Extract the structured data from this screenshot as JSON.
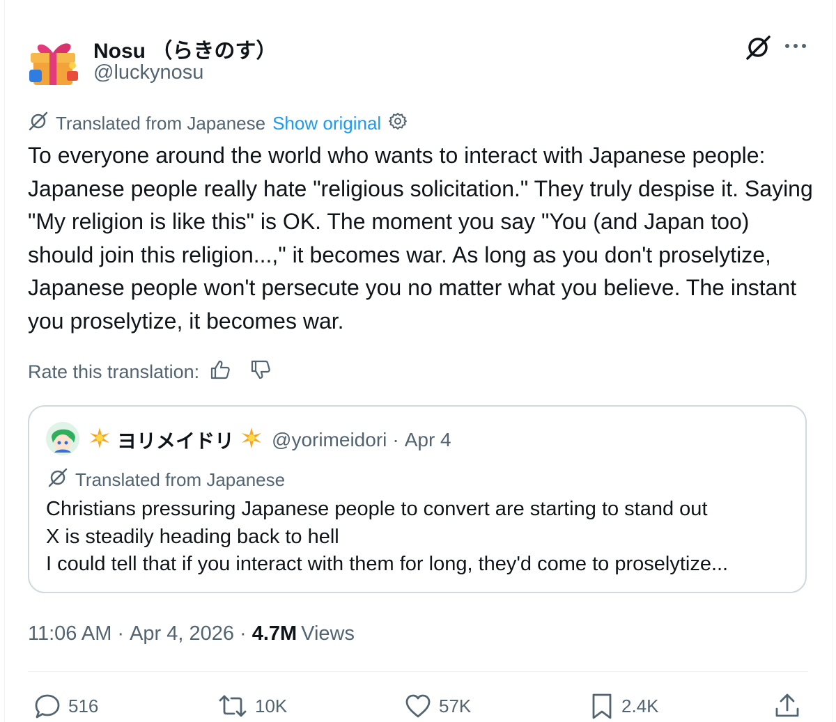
{
  "author": {
    "display_name": "Nosu （らきのす）",
    "handle": "@luckynosu"
  },
  "translation": {
    "label": "Translated from Japanese",
    "show_original": "Show original"
  },
  "post_text": "To everyone around the world who wants to interact with Japanese people: Japanese people really hate \"religious solicitation.\" They truly despise it. Saying \"My religion is like this\" is OK. The moment you say \"You (and Japan too) should join this religion...,\" it becomes war. As long as you don't proselytize, Japanese people won't persecute you no matter what you believe. The instant you proselytize, it becomes war.",
  "rate": {
    "label": "Rate this translation:"
  },
  "quote": {
    "display_name": "ヨリメイドリ",
    "handle": "@yorimeidori",
    "dot": "·",
    "date": "Apr 4",
    "translation_label": "Translated from Japanese",
    "lines": [
      "Christians pressuring Japanese people to convert are starting to stand out",
      "X is steadily heading back to hell",
      "I could tell that if you interact with them for long, they'd come to proselytize..."
    ]
  },
  "meta": {
    "time": "11:06 AM",
    "sep1": "·",
    "date": "Apr 4, 2026",
    "sep2": "·",
    "views_count": "4.7M",
    "views_label": "Views"
  },
  "actions": {
    "replies": "516",
    "reposts": "10K",
    "likes": "57K",
    "bookmarks": "2.4K"
  },
  "colors": {
    "link": "#1d9bf0",
    "secondary_text": "#536471",
    "primary_text": "#0f1419",
    "border": "#cfd9de"
  },
  "icons": [
    "grok-icon",
    "more-icon",
    "translate-icon",
    "settings-gear-icon",
    "thumbs-up-icon",
    "thumbs-down-icon",
    "reply-icon",
    "repost-icon",
    "like-icon",
    "bookmark-icon",
    "share-icon",
    "sparkle-star-icon"
  ]
}
